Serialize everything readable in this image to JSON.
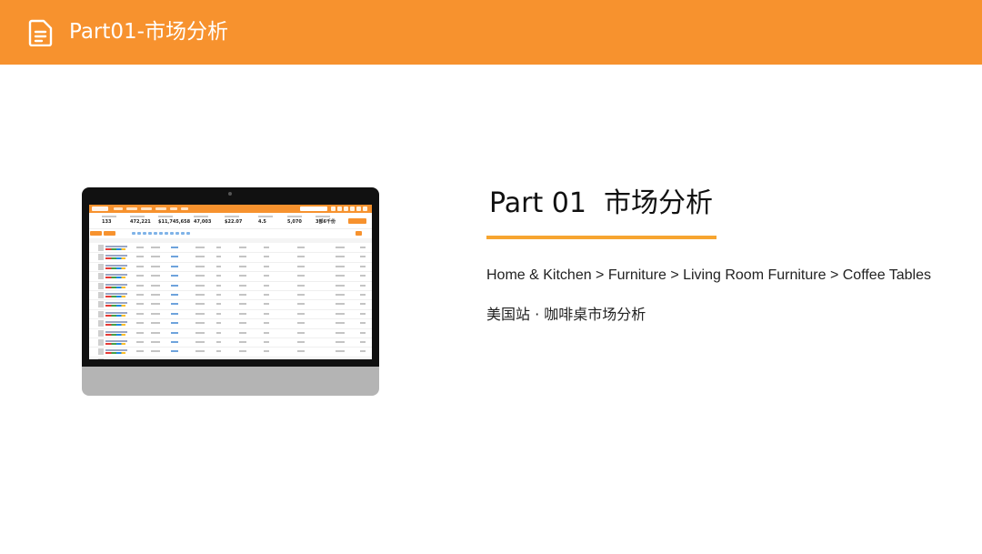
{
  "header": {
    "title": "Part01-市场分析",
    "bar_color": "#f7922e",
    "icon": "document-icon"
  },
  "section": {
    "title": "Part 01  市场分析",
    "rule_color": "#f7a530",
    "breadcrumb": "Home & Kitchen > Furniture > Living Room Furniture > Coffee Tables",
    "subtitle": "美国站 · 咖啡桌市场分析"
  },
  "monitor_screen": {
    "stats": [
      "133",
      "472,221",
      "$11,745,658",
      "47,003",
      "$22.07",
      "4.5",
      "5,070",
      "3部6千份"
    ]
  }
}
